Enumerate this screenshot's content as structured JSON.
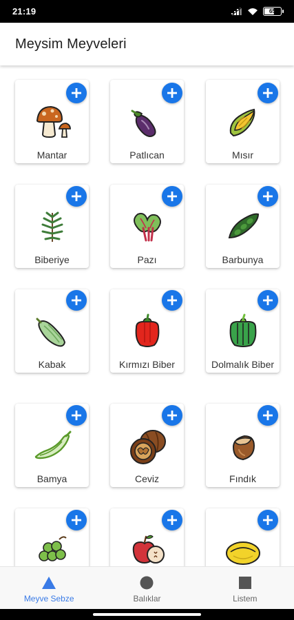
{
  "status_bar": {
    "time": "21:19",
    "battery_text": "65",
    "battery_level": 0.65
  },
  "app_bar": {
    "title": "Meysim Meyveleri"
  },
  "colors": {
    "accent": "#1976e8",
    "nav_active": "#3a7be6",
    "nav_inactive": "#555555"
  },
  "grid": {
    "add_icon": "plus-icon",
    "items": [
      {
        "label": "Mantar",
        "icon": "mushroom-icon"
      },
      {
        "label": "Patlıcan",
        "icon": "eggplant-icon"
      },
      {
        "label": "Mısır",
        "icon": "corn-icon"
      },
      {
        "label": "Biberiye",
        "icon": "rosemary-icon"
      },
      {
        "label": "Pazı",
        "icon": "chard-icon"
      },
      {
        "label": "Barbunya",
        "icon": "bean-pod-icon"
      },
      {
        "label": "Kabak",
        "icon": "zucchini-icon"
      },
      {
        "label": "Kırmızı Biber",
        "icon": "red-pepper-icon"
      },
      {
        "label": "Dolmalık Biber",
        "icon": "green-pepper-icon"
      },
      {
        "label": "Bamya",
        "icon": "okra-icon"
      },
      {
        "label": "Ceviz",
        "icon": "walnut-icon"
      },
      {
        "label": "Fındık",
        "icon": "hazelnut-icon"
      },
      {
        "label": "",
        "icon": "grapes-icon"
      },
      {
        "label": "",
        "icon": "apple-icon"
      },
      {
        "label": "",
        "icon": "melon-icon"
      }
    ]
  },
  "bottom_nav": {
    "items": [
      {
        "label": "Meyve Sebze",
        "icon": "triangle-icon",
        "active": true
      },
      {
        "label": "Balıklar",
        "icon": "circle-icon",
        "active": false
      },
      {
        "label": "Listem",
        "icon": "square-icon",
        "active": false
      }
    ]
  }
}
